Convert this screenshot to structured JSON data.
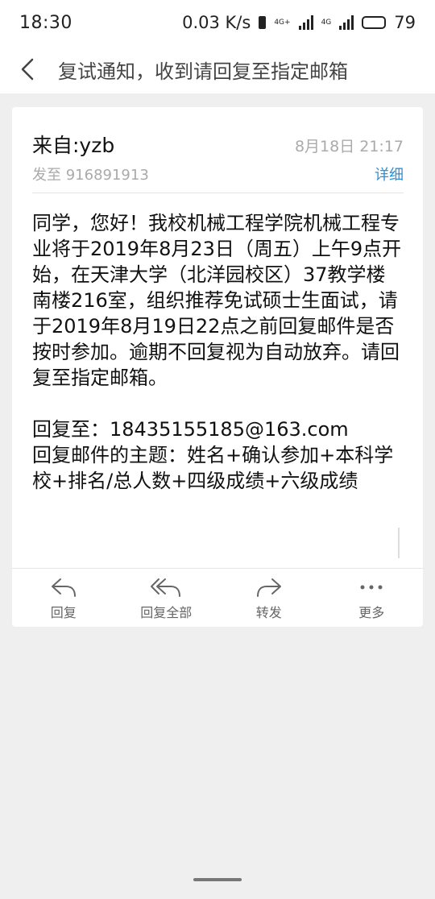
{
  "status_bar": {
    "time": "18:30",
    "net_speed": "0.03 K/s",
    "network_1": "4G+",
    "network_2": "4G",
    "battery": "79"
  },
  "header": {
    "title": "复试通知，收到请回复至指定邮箱"
  },
  "message": {
    "from": "来自:yzb",
    "date": "8月18日 21:17",
    "to": "发至 916891913",
    "detail_link": "详细",
    "body_paragraph": "同学，您好！我校机械工程学院机械工程专业将于2019年8月23日（周五）上午9点开始，在天津大学（北洋园校区）37教学楼南楼216室，组织推荐免试硕士生面试，请于2019年8月19日22点之前回复邮件是否按时参加。逾期不回复视为自动放弃。请回复至指定邮箱。",
    "reply_to": "回复至：18435155185@163.com",
    "reply_subject": "回复邮件的主题：姓名+确认参加+本科学校+排名/总人数+四级成绩+六级成绩"
  },
  "actions": [
    {
      "label": "回复",
      "icon": "reply-icon"
    },
    {
      "label": "回复全部",
      "icon": "reply-all-icon"
    },
    {
      "label": "转发",
      "icon": "forward-icon"
    },
    {
      "label": "更多",
      "icon": "more-icon"
    }
  ]
}
